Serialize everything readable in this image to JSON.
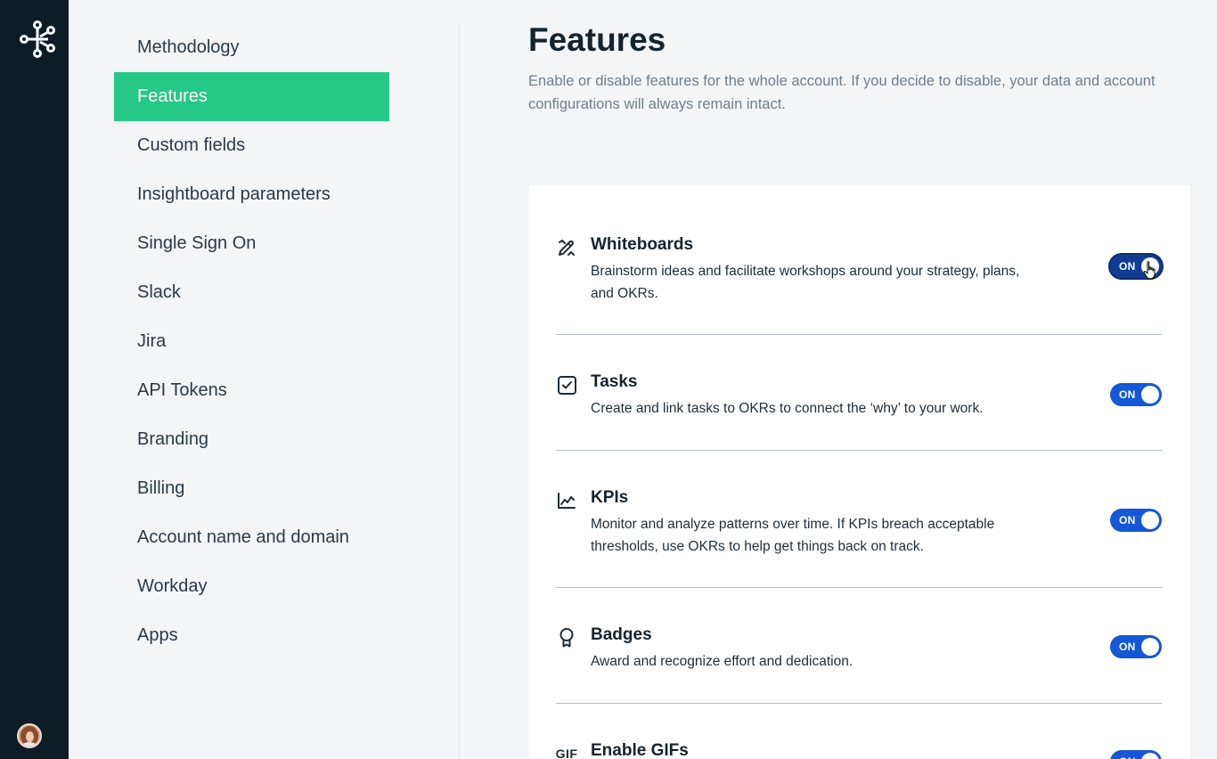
{
  "settings_nav": {
    "items": [
      {
        "label": "Methodology",
        "active": false
      },
      {
        "label": "Features",
        "active": true
      },
      {
        "label": "Custom fields",
        "active": false
      },
      {
        "label": "Insightboard parameters",
        "active": false
      },
      {
        "label": "Single Sign On",
        "active": false
      },
      {
        "label": "Slack",
        "active": false
      },
      {
        "label": "Jira",
        "active": false
      },
      {
        "label": "API Tokens",
        "active": false
      },
      {
        "label": "Branding",
        "active": false
      },
      {
        "label": "Billing",
        "active": false
      },
      {
        "label": "Account name and domain",
        "active": false
      },
      {
        "label": "Workday",
        "active": false
      },
      {
        "label": "Apps",
        "active": false
      }
    ]
  },
  "page": {
    "title": "Features",
    "description": "Enable or disable features for the whole account. If you decide to disable, your data and account configurations will always remain intact."
  },
  "features": [
    {
      "icon": "pencil-ruler-icon",
      "name": "Whiteboards",
      "description": "Brainstorm ideas and facilitate workshops around your strategy, plans, and OKRs.",
      "toggle": "ON"
    },
    {
      "icon": "checkbox-icon",
      "name": "Tasks",
      "description": "Create and link tasks to OKRs to connect the ‘why’ to your work.",
      "toggle": "ON"
    },
    {
      "icon": "line-chart-icon",
      "name": "KPIs",
      "description": "Monitor and analyze patterns over time. If KPIs breach acceptable thresholds, use OKRs to help get things back on track.",
      "toggle": "ON"
    },
    {
      "icon": "badge-icon",
      "name": "Badges",
      "description": "Award and recognize effort and dedication.",
      "toggle": "ON"
    },
    {
      "icon": "gif-icon",
      "icon_text": "GIF",
      "name": "Enable GIFs",
      "description": "",
      "toggle": "ON"
    }
  ],
  "colors": {
    "rail": "#0e1c26",
    "nav_active": "#26c887",
    "toggle_on": "#1458d6"
  }
}
